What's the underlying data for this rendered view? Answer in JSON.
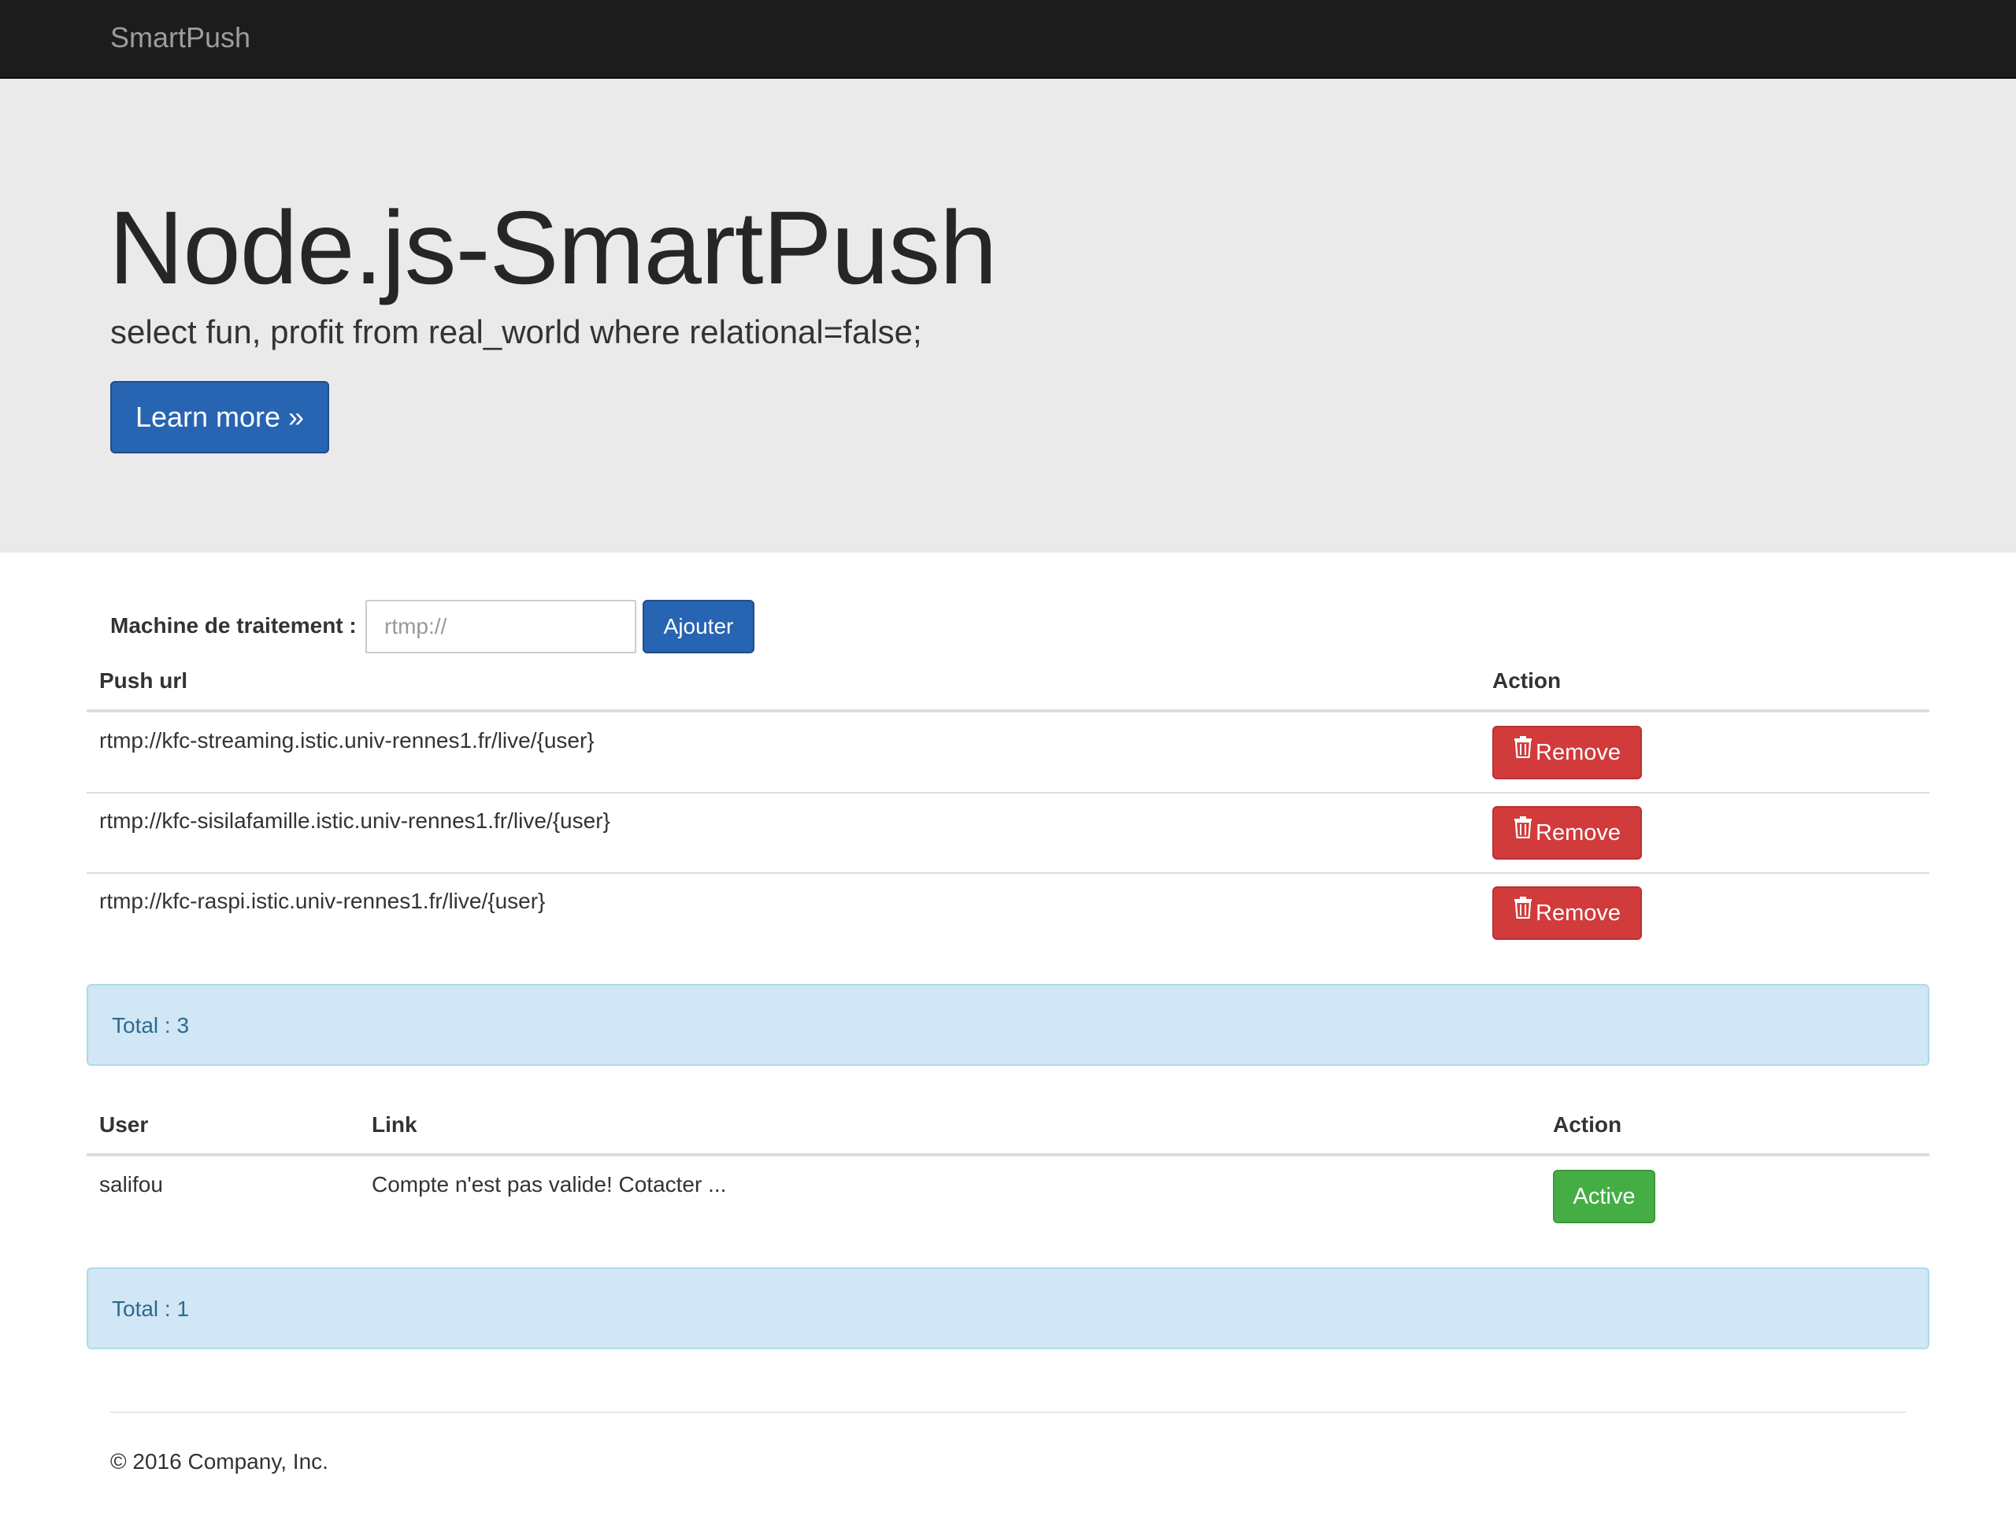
{
  "navbar": {
    "brand": "SmartPush"
  },
  "jumbotron": {
    "title": "Node.js-SmartPush",
    "lead": "select fun, profit from real_world where relational=false;",
    "learn_more_label": "Learn more »"
  },
  "push_form": {
    "label": "Machine de traitement :",
    "input_value": "",
    "input_placeholder": "rtmp://",
    "add_label": "Ajouter"
  },
  "push_table": {
    "headers": [
      "Push url",
      "Action"
    ],
    "rows": [
      {
        "url": "rtmp://kfc-streaming.istic.univ-rennes1.fr/live/{user}",
        "action_label": "Remove",
        "action_icon": "trash-icon"
      },
      {
        "url": "rtmp://kfc-sisilafamille.istic.univ-rennes1.fr/live/{user}",
        "action_label": "Remove",
        "action_icon": "trash-icon"
      },
      {
        "url": "rtmp://kfc-raspi.istic.univ-rennes1.fr/live/{user}",
        "action_label": "Remove",
        "action_icon": "trash-icon"
      }
    ],
    "total": "Total : 3"
  },
  "user_table": {
    "headers": [
      "User",
      "Link",
      "Action"
    ],
    "rows": [
      {
        "user": "salifou",
        "link": "Compte n'est pas valide! Cotacter ...",
        "action_label": "Active"
      }
    ],
    "total": "Total : 1"
  },
  "footer": {
    "text": "© 2016 Company, Inc."
  },
  "colors": {
    "navbar_bg": "#1c1c1c",
    "jumbotron_bg": "#eaeaea",
    "primary": "#2764b2",
    "danger": "#d13b3b",
    "success": "#44ae44",
    "info_bg": "#d1e7f5",
    "info_text": "#2d6a93"
  }
}
